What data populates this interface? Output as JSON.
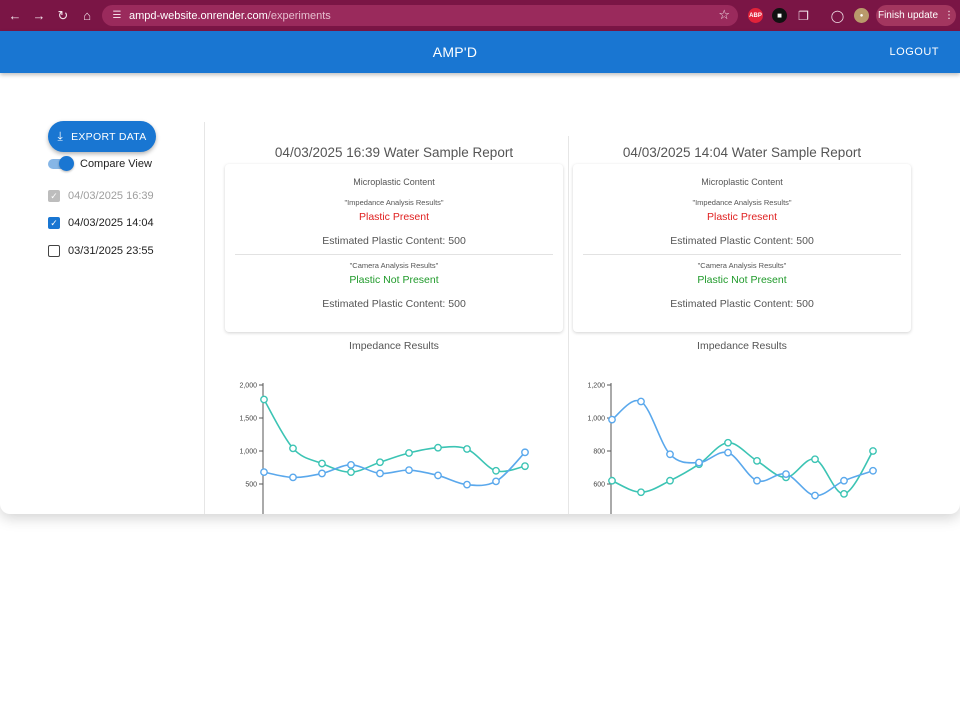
{
  "browser": {
    "url_host": "ampd-website.onrender.com",
    "url_path": "/experiments",
    "abp_label": "ABP",
    "finish_update": "Finish update"
  },
  "header": {
    "title": "AMP'D",
    "logout": "LOGOUT"
  },
  "sidebar": {
    "export_label": "EXPORT DATA",
    "compare_label": "Compare View",
    "compare_on": true,
    "reports": [
      {
        "label": "04/03/2025 16:39",
        "state": "checked-disabled"
      },
      {
        "label": "04/03/2025 14:04",
        "state": "checked"
      },
      {
        "label": "03/31/2025 23:55",
        "state": "unchecked"
      }
    ]
  },
  "panels": [
    {
      "title": "04/03/2025 16:39 Water Sample Report",
      "card_heading": "Microplastic Content",
      "impedance_label": "\"Impedance Analysis Results\"",
      "impedance_result": "Plastic Present",
      "impedance_estimate": "Estimated Plastic Content: 500",
      "camera_label": "\"Camera Analysis Results\"",
      "camera_result": "Plastic Not Present",
      "camera_estimate": "Estimated Plastic Content: 500",
      "chart_title": "Impedance Results"
    },
    {
      "title": "04/03/2025 14:04 Water Sample Report",
      "card_heading": "Microplastic Content",
      "impedance_label": "\"Impedance Analysis Results\"",
      "impedance_result": "Plastic Present",
      "impedance_estimate": "Estimated Plastic Content: 500",
      "camera_label": "\"Camera Analysis Results\"",
      "camera_result": "Plastic Not Present",
      "camera_estimate": "Estimated Plastic Content: 500",
      "chart_title": "Impedance Results"
    }
  ],
  "colors": {
    "header": "#1976d2",
    "chrome": "#7a1545",
    "series_teal": "#3cc4b4",
    "series_blue": "#5aa8ec"
  },
  "chart_data": [
    {
      "type": "line",
      "title": "Impedance Results",
      "x": [
        0,
        1,
        2,
        3,
        4,
        5,
        6,
        7,
        8,
        9
      ],
      "ylim": [
        0,
        2000
      ],
      "yticks": [
        500,
        1000,
        1500,
        2000
      ],
      "ytick_labels": [
        "500",
        "1,000",
        "1,500",
        "2,000"
      ],
      "series": [
        {
          "color": "#3cc4b4",
          "values": [
            1780,
            1040,
            810,
            680,
            830,
            970,
            1050,
            1030,
            700,
            770
          ]
        },
        {
          "color": "#5aa8ec",
          "values": [
            680,
            600,
            660,
            790,
            660,
            710,
            630,
            490,
            540,
            980
          ]
        }
      ]
    },
    {
      "type": "line",
      "title": "Impedance Results",
      "x": [
        0,
        1,
        2,
        3,
        4,
        5,
        6,
        7,
        8,
        9
      ],
      "ylim": [
        400,
        1200
      ],
      "yticks": [
        600,
        800,
        1000,
        1200
      ],
      "ytick_labels": [
        "600",
        "800",
        "1,000",
        "1,200"
      ],
      "series": [
        {
          "color": "#3cc4b4",
          "values": [
            620,
            550,
            620,
            720,
            850,
            740,
            640,
            750,
            540,
            800
          ]
        },
        {
          "color": "#5aa8ec",
          "values": [
            990,
            1100,
            780,
            730,
            790,
            620,
            660,
            530,
            620,
            680
          ]
        }
      ]
    }
  ]
}
